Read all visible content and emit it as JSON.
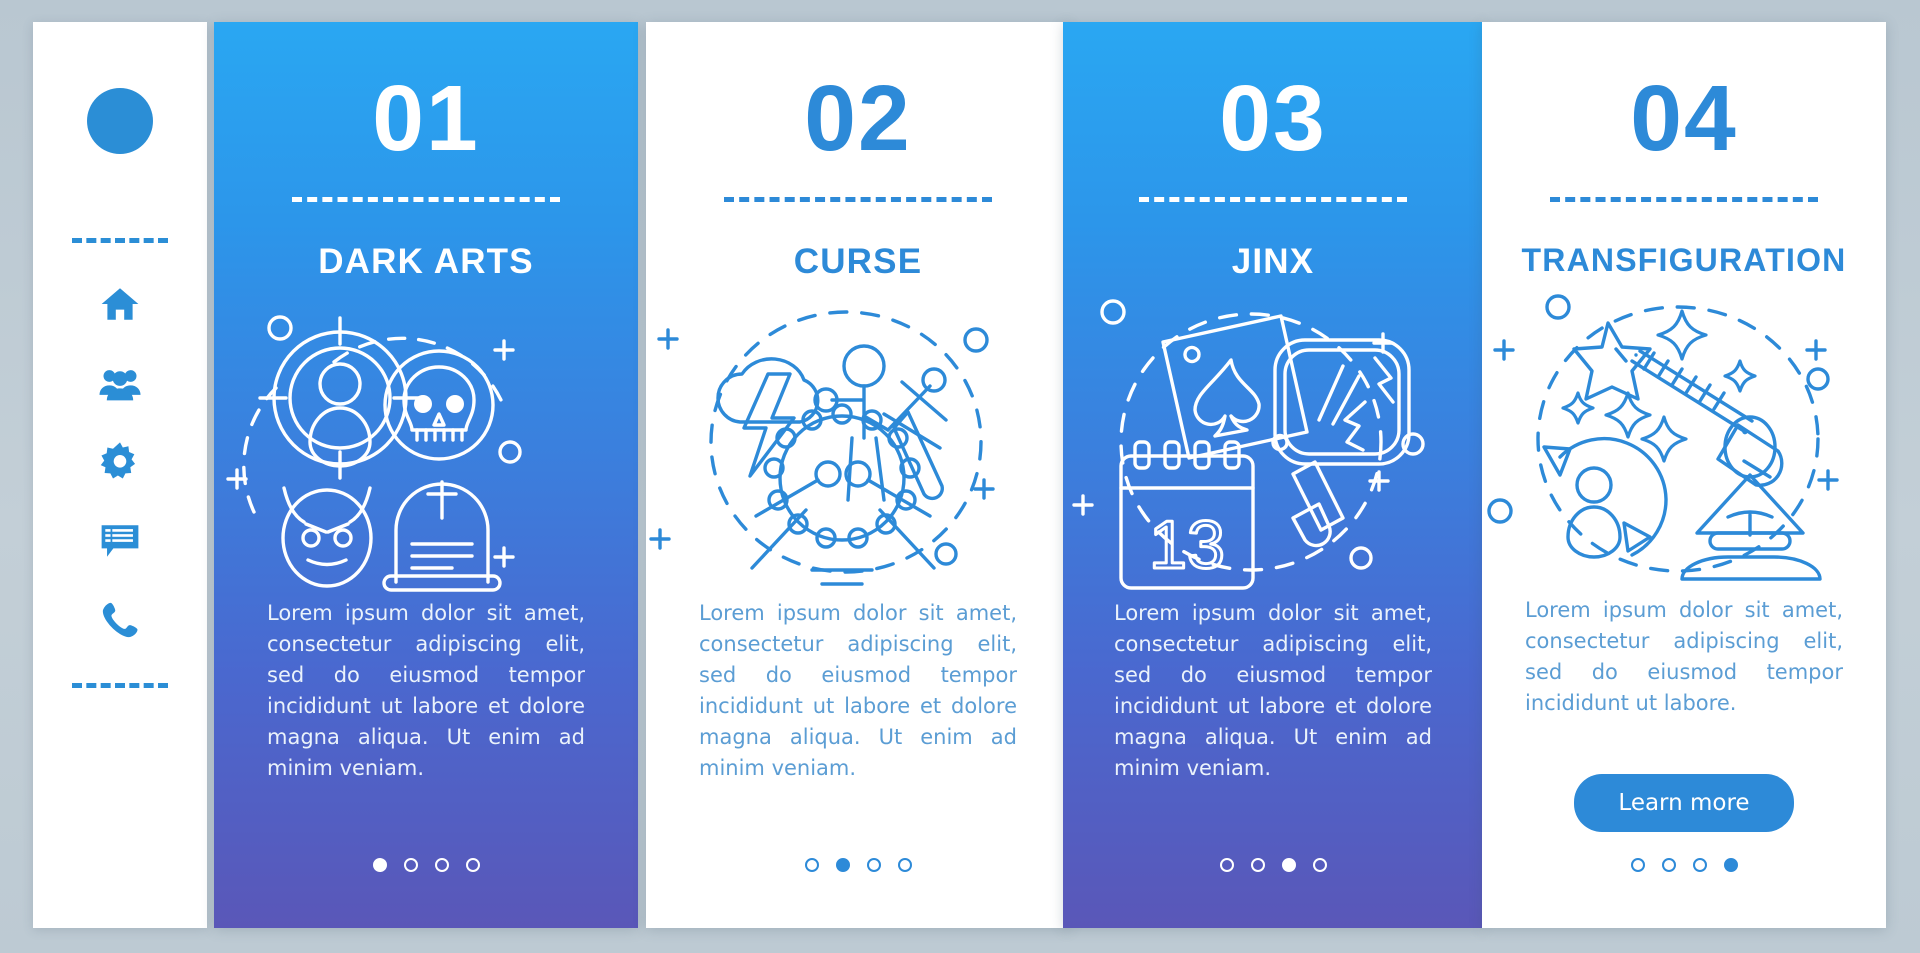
{
  "background_color": "#bcc9d2",
  "accent_color": "#2d8ad8",
  "gradient_top": "#2aa7f2",
  "gradient_bottom": "#5a57b8",
  "sidebar": {
    "avatar_label": "avatar",
    "items": [
      {
        "icon": "home-icon",
        "label": "Home"
      },
      {
        "icon": "users-icon",
        "label": "Community"
      },
      {
        "icon": "gear-icon",
        "label": "Settings"
      },
      {
        "icon": "chat-icon",
        "label": "Messages"
      },
      {
        "icon": "phone-icon",
        "label": "Contact"
      }
    ]
  },
  "cards": [
    {
      "number": "01",
      "title": "DARK ARTS",
      "body": "Lorem ipsum dolor sit amet, consectetur adipiscing elit, sed do eiusmod tempor incididunt ut labore et dolore magna aliqua. Ut enim ad minim veniam.",
      "style": "blue",
      "illustration": "target-person-skull-devil-tombstone",
      "dots": 4,
      "active_dot": 0,
      "cta": null
    },
    {
      "number": "02",
      "title": "CURSE",
      "body": "Lorem ipsum dolor sit amet, consectetur adipiscing elit, sed do eiusmod tempor incididunt ut labore et dolore magna aliqua. Ut enim ad minim veniam.",
      "style": "white",
      "illustration": "storm-cloud-voodoo-doll-cauldron",
      "dots": 4,
      "active_dot": 1,
      "cta": null
    },
    {
      "number": "03",
      "title": "JINX",
      "body": "Lorem ipsum dolor sit amet, consectetur adipiscing elit, sed do eiusmod tempor incididunt ut labore et dolore magna aliqua. Ut enim ad minim veniam.",
      "style": "blue",
      "illustration": "ace-of-spades-broken-mirror-calendar-13",
      "calendar_day": "13",
      "dots": 4,
      "active_dot": 2,
      "cta": null
    },
    {
      "number": "04",
      "title": "TRANSFIGURATION",
      "body": "Lorem ipsum dolor sit amet, consectetur adipiscing elit, sed do eiusmod tempor incididunt ut labore.",
      "style": "white",
      "illustration": "magic-wand-sparkles-person-cycle-meditating-figure",
      "dots": 4,
      "active_dot": 3,
      "cta": "Learn more"
    }
  ]
}
